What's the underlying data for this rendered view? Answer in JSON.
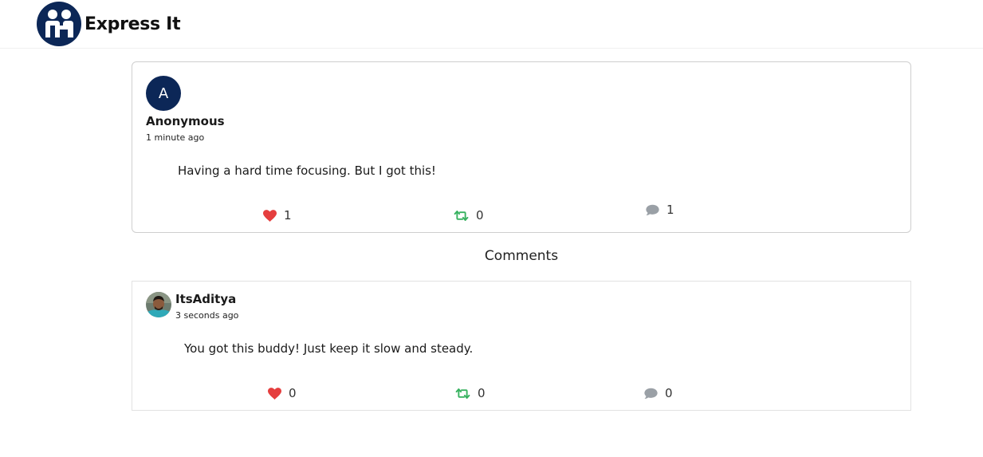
{
  "app": {
    "name": "Express It"
  },
  "post": {
    "avatar_letter": "A",
    "author": "Anonymous",
    "time": "1 minute ago",
    "content": "Having a hard time focusing. But I got this!",
    "likes": "1",
    "reposts": "0",
    "comments": "1"
  },
  "comments_section": {
    "heading": "Comments",
    "items": [
      {
        "author": "ItsAditya",
        "time": "3 seconds ago",
        "content": "You got this buddy! Just keep it slow and steady.",
        "likes": "0",
        "reposts": "0",
        "comments": "0"
      }
    ]
  },
  "colors": {
    "brand": "#0c2757",
    "like": "#e53e3e",
    "repost": "#38b260",
    "comment": "#9aa0a6"
  },
  "icons": {
    "like": "heart-icon",
    "repost": "repost-icon",
    "comment": "comment-icon"
  }
}
